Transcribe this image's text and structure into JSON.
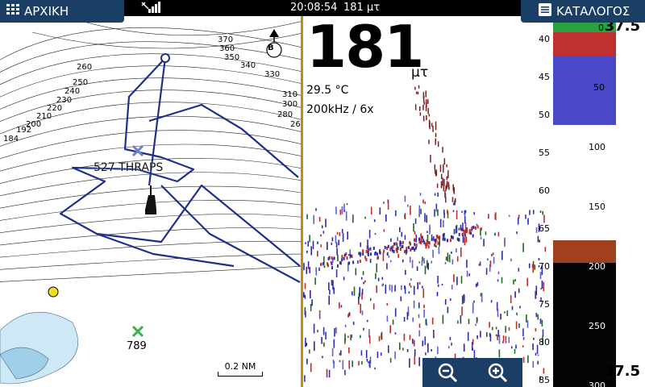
{
  "topbar": {
    "home_label": "ΑΡΧΙΚΗ",
    "menu_label": "ΚΑΤΑΛΟΓΟΣ",
    "time": "20:08:54",
    "depth_readout": "181 μτ"
  },
  "chart": {
    "waypoint_label": "527 THRAPS",
    "waypoint_marker_label": "789",
    "buoy_label": "B",
    "scale_label": "0.2 NM",
    "contour_labels": [
      "370",
      "360",
      "350",
      "340",
      "330",
      "310",
      "300",
      "280",
      "260",
      "250",
      "240",
      "230",
      "220",
      "210",
      "200",
      "192",
      "184"
    ],
    "colors": {
      "track": "#1e2f8c",
      "boat": "#111111"
    }
  },
  "sonar": {
    "depth": "181",
    "depth_unit": "μτ",
    "temperature": "29.5 °C",
    "frequency": "200kHz / 6x",
    "range_top": "37.5",
    "range_bottom": "37.5",
    "depth_scale": [
      "40",
      "45",
      "50",
      "55",
      "60",
      "65",
      "70",
      "75",
      "80",
      "85"
    ],
    "overview_scale": [
      "0",
      "50",
      "100",
      "150",
      "200",
      "250",
      "300"
    ]
  },
  "icons": [
    "grid-icon",
    "signal-icon",
    "list-icon",
    "zoom-out-icon",
    "zoom-in-icon",
    "boat-icon",
    "north-arrow-icon"
  ]
}
